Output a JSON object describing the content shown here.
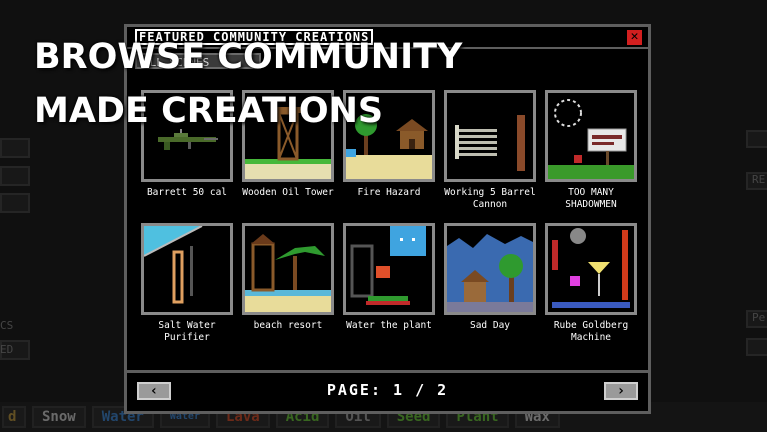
{
  "caption": {
    "line1": "BROWSE COMMUNITY",
    "line2": "MADE CREATIONS"
  },
  "modal": {
    "title": "FEATURED COMMUNITY CREATIONS",
    "subtab": "ALL SCENES",
    "close_icon": "close-icon"
  },
  "creations": [
    {
      "title": "Barrett 50 cal"
    },
    {
      "title": "Wooden Oil Tower"
    },
    {
      "title": "Fire Hazard"
    },
    {
      "title": "Working 5 Barrel Cannon"
    },
    {
      "title": "TOO MANY SHADOWMEN"
    },
    {
      "title": "Salt Water Purifier"
    },
    {
      "title": "beach resort"
    },
    {
      "title": "Water the plant"
    },
    {
      "title": "Sad Day"
    },
    {
      "title": "Rube Goldberg Machine"
    }
  ],
  "pagination": {
    "page_text": "PAGE: 1 / 2",
    "prev_icon": "chevron-left-icon",
    "next_icon": "chevron-right-icon"
  },
  "background": {
    "materials": [
      "d",
      "Snow",
      "Water",
      "Water",
      "Lava",
      "Acid",
      "Oil",
      "Seed",
      "Plant",
      "Wax"
    ],
    "side_labels": [
      "CS",
      "ED",
      "RE",
      "E",
      "Pe"
    ]
  },
  "colors": {
    "close": "#d21f1f",
    "border": "#5e5e5e"
  }
}
